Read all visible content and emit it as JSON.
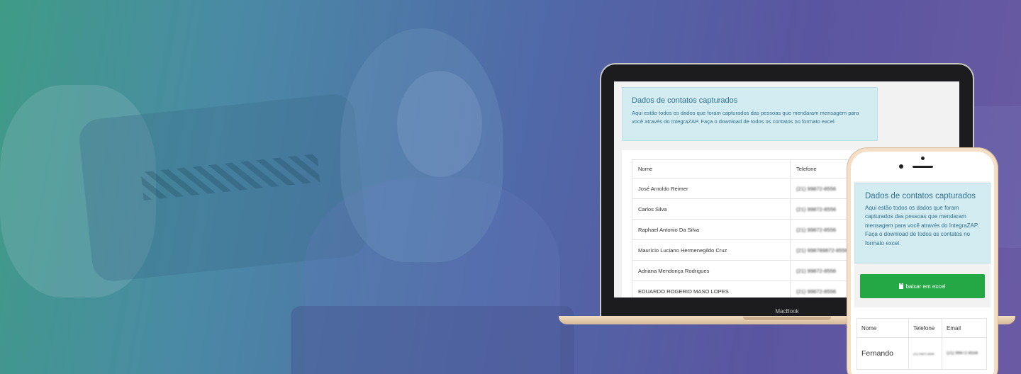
{
  "laptop": {
    "brand": "MacBook",
    "info_title": "Dados de contatos capturados",
    "info_text": "Aqui estão todos os dados que foram capturados das pessoas que mendaram mensagem para você através do IntegraZAP. Faça o download de todos os contatos no formato excel.",
    "table": {
      "headers": [
        "Nome",
        "Telefone"
      ],
      "rows": [
        {
          "name": "José Arnoldo Reimer",
          "phone": "(21) 99872-8556"
        },
        {
          "name": "Carlos Silva",
          "phone": "(21) 99872-8556"
        },
        {
          "name": "Raphael Antonio Da Silva",
          "phone": "(21) 99872-8556"
        },
        {
          "name": "Maurício Luciano Hermenegildo Cruz",
          "phone": "(21) 998789872-8556"
        },
        {
          "name": "Adriana Mendonça Rodrigues",
          "phone": "(21) 99872-8556"
        },
        {
          "name": "EDUARDO ROGERIO MASO LOPES",
          "phone": "(21) 99872-8556"
        }
      ]
    }
  },
  "phone": {
    "info_title": "Dados de contatos capturados",
    "info_text": "Aqui estão todos os dados que foram capturados das pessoas que mendaram mensagem para você através do IntegraZAP. Faça o download de todos os contatos no formato excel.",
    "download_button": "baixar em excel",
    "download_icon": "excel-file-icon",
    "table": {
      "headers": [
        "Nome",
        "Telefone",
        "Email"
      ],
      "rows": [
        {
          "name": "Fernando",
          "phone": "(21) 99872-8556",
          "email": "(21) 99872-8556"
        }
      ]
    }
  },
  "colors": {
    "info_bg": "#d2ecf1",
    "info_text": "#31708f",
    "button_green": "#24a745"
  }
}
